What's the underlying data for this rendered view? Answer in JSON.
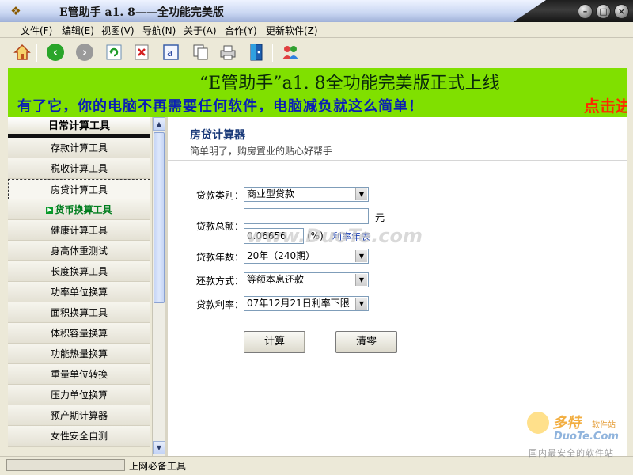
{
  "window": {
    "title": "E管助手 a1. 8——全功能完美版",
    "buttons": [
      "minimize",
      "maximize",
      "close"
    ]
  },
  "menu": [
    "文件(F)",
    "编辑(E)",
    "视图(V)",
    "导航(N)",
    "关于(A)",
    "合作(Y)",
    "更新软件(Z)"
  ],
  "toolbar": {
    "icons": [
      "home-icon",
      "back-icon",
      "forward-icon",
      "refresh-icon",
      "stop-icon",
      "address-icon",
      "copy-icon",
      "print-icon",
      "exit-icon",
      "users-icon"
    ]
  },
  "banner": {
    "headline": "“E管助手”a1. 8全功能完美版正式上线",
    "slogan": "有了它，你的电脑不再需要任何软件，电脑减负就这么简单！",
    "click_link": "点击进"
  },
  "sidebar": {
    "header": "日常计算工具",
    "items": [
      "存款计算工具",
      "税收计算工具",
      "房贷计算工具",
      "货币换算工具",
      "健康计算工具",
      "身高体重测试",
      "长度换算工具",
      "功率单位换算",
      "面积换算工具",
      "体积容量换算",
      "功能热量换算",
      "重量单位转换",
      "压力单位换算",
      "预产期计算器",
      "女性安全自测"
    ],
    "selected_index": 2,
    "active_index": 3
  },
  "content": {
    "title": "房贷计算器",
    "subtitle": "简单明了，购房置业的贴心好帮手",
    "form": {
      "loan_type_label": "贷款类别：",
      "loan_type_value": "商业型贷款",
      "amount_label": "贷款总额：",
      "amount_value": "",
      "amount_unit": "元",
      "rate_value": "0.06656",
      "rate_unit": "(%)",
      "rate_link": "利率年表",
      "years_label": "贷款年数：",
      "years_value": "20年（240期）",
      "repay_label": "还款方式：",
      "repay_value": "等额本息还款",
      "rate_label": "贷款利率：",
      "rate_select_value": "07年12月21日利率下限"
    },
    "buttons": {
      "calc": "计算",
      "clear": "清零"
    },
    "watermark": "www.DuoTe.com"
  },
  "status": {
    "text": "上网必备工具"
  },
  "logo": {
    "name": "多特",
    "cn": "软件站",
    "domain": "DuoTe.Com",
    "tagline": "国内最安全的软件站"
  },
  "colors": {
    "banner_bg": "#80e000",
    "slogan": "#0a1fb5",
    "click_link": "#ff2a00",
    "active_item": "#007d1e",
    "content_title": "#1b3b7a"
  }
}
